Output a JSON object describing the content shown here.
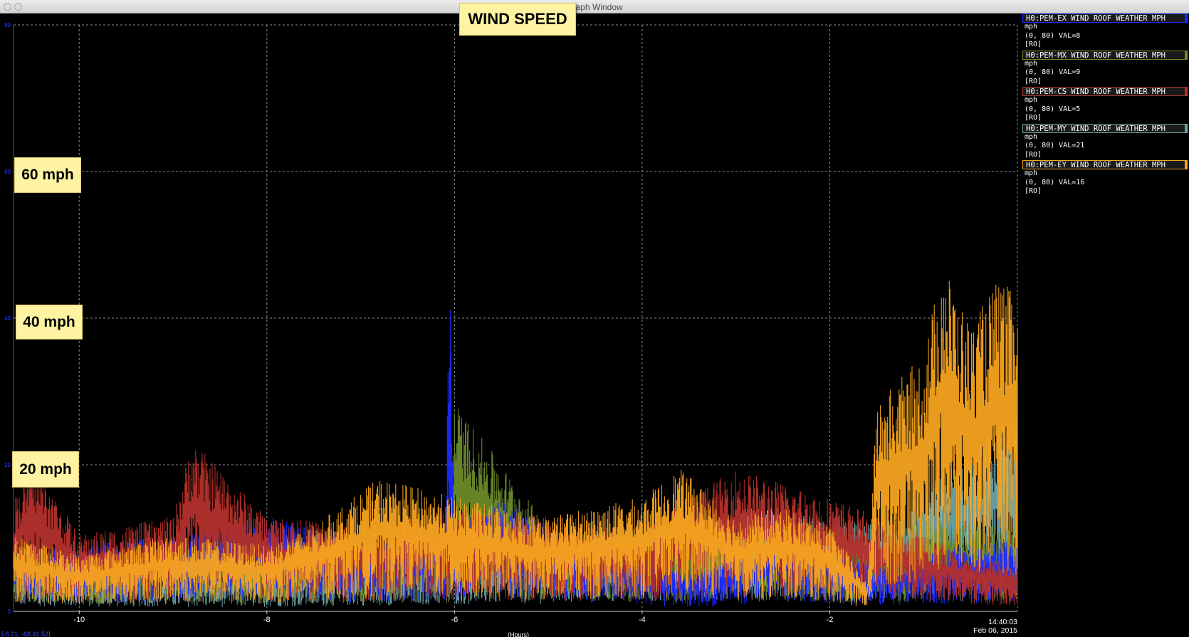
{
  "window": {
    "title": "Graph Window"
  },
  "chart_data": {
    "type": "line",
    "title": "WIND SPEED",
    "xlabel": "(Hours)",
    "ylabel": "",
    "xlim": [
      -10.7,
      0
    ],
    "ylim": [
      0,
      80
    ],
    "x_ticks": [
      -10,
      -8,
      -6,
      -4,
      -2
    ],
    "x_tick_labels": [
      "-10",
      "-8",
      "-6",
      "-4",
      "-2"
    ],
    "y_ticks": [
      0,
      20,
      40,
      60,
      80
    ],
    "y_tick_labels": [
      "0",
      "20",
      "40",
      "60",
      "80"
    ],
    "end_time": "14:40:03",
    "end_date": "Feb 06, 2015",
    "corner_readout": "[-6.21, -68.41.52]",
    "grid": true,
    "legend_position": "right",
    "series": [
      {
        "name": "H0:PEM-EX_WIND_ROOF_WEATHER_MPH",
        "unit": "mph",
        "range_text": "(0, 80) VAL=8",
        "mode": "[RO]",
        "color": "#1a2bff",
        "x": [
          -10.7,
          -10.0,
          -9.0,
          -8.0,
          -7.0,
          -6.1,
          -6.05,
          -6.0,
          -5.5,
          -5.0,
          -4.5,
          -4.0,
          -3.5,
          -3.0,
          -2.5,
          -2.0,
          -1.5,
          -1.0,
          -0.5,
          0
        ],
        "values": [
          6,
          7,
          8,
          10,
          8,
          9,
          36,
          10,
          12,
          9,
          8,
          6,
          4,
          6,
          8,
          7,
          5,
          6,
          7,
          8
        ]
      },
      {
        "name": "H0:PEM-MX_WIND_ROOF_WEATHER_MPH",
        "unit": "mph",
        "range_text": "(0, 80) VAL=9",
        "mode": "[RO]",
        "color": "#6b8a2a",
        "x": [
          -10.7,
          -10.0,
          -9.0,
          -8.0,
          -7.0,
          -6.05,
          -6.0,
          -5.0,
          -4.0,
          -3.0,
          -2.0,
          -1.5,
          -1.0,
          -0.5,
          0
        ],
        "values": [
          7,
          6,
          7,
          6,
          7,
          8,
          22,
          9,
          8,
          9,
          8,
          7,
          10,
          9,
          9
        ]
      },
      {
        "name": "H0:PEM-CS_WIND_ROOF_WEATHER_MPH",
        "unit": "mph",
        "range_text": "(0, 80) VAL=5",
        "mode": "[RO]",
        "color": "#b3302b",
        "x": [
          -10.7,
          -10.5,
          -10.0,
          -9.0,
          -8.8,
          -8.0,
          -7.0,
          -6.0,
          -5.0,
          -4.0,
          -3.0,
          -2.0,
          -1.5,
          -1.0,
          -0.5,
          0
        ],
        "values": [
          12,
          16,
          8,
          10,
          18,
          10,
          9,
          11,
          10,
          9,
          15,
          12,
          10,
          8,
          6,
          5
        ]
      },
      {
        "name": "H0:PEM-MY_WIND_ROOF_WEATHER_MPH",
        "unit": "mph",
        "range_text": "(0, 80) VAL=21",
        "mode": "[RO]",
        "color": "#6aa3a8",
        "x": [
          -10.7,
          -10.0,
          -9.0,
          -8.0,
          -7.0,
          -6.0,
          -5.0,
          -4.0,
          -3.0,
          -2.0,
          -1.5,
          -1.0,
          -0.5,
          0
        ],
        "values": [
          5,
          4,
          4,
          4,
          5,
          6,
          7,
          9,
          11,
          10,
          9,
          13,
          17,
          21
        ]
      },
      {
        "name": "H0:PEM-EY_WIND_ROOF_WEATHER_MPH",
        "unit": "mph",
        "range_text": "(0, 80) VAL=16",
        "mode": "[RO]",
        "color": "#f5a31f",
        "x": [
          -10.7,
          -10.0,
          -9.0,
          -8.0,
          -7.5,
          -6.8,
          -6.0,
          -5.0,
          -4.0,
          -3.6,
          -3.0,
          -2.5,
          -2.0,
          -1.6,
          -1.5,
          -1.0,
          -0.8,
          -0.5,
          -0.2,
          0
        ],
        "values": [
          8,
          6,
          8,
          7,
          9,
          14,
          12,
          10,
          12,
          15,
          10,
          11,
          9,
          3,
          22,
          27,
          37,
          30,
          35,
          33
        ]
      }
    ],
    "annotations": [
      "WIND SPEED",
      "60 mph",
      "40 mph",
      "20 mph"
    ]
  }
}
